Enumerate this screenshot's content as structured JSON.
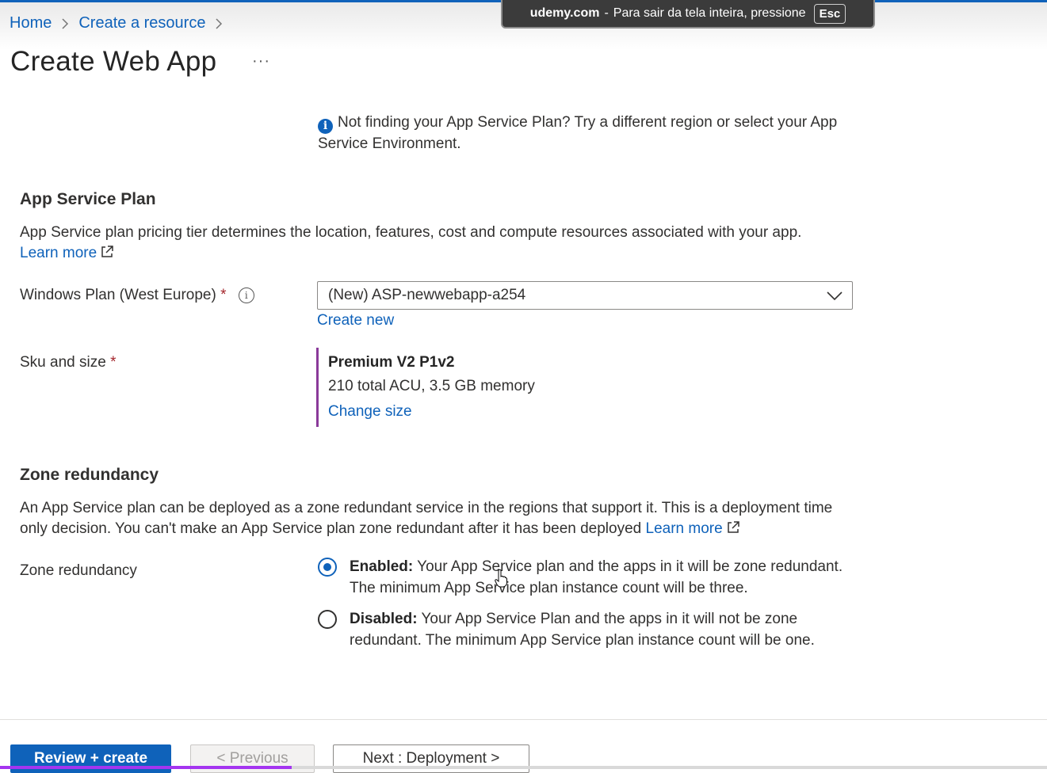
{
  "breadcrumb": {
    "items": [
      "Home",
      "Create a resource"
    ]
  },
  "page": {
    "title": "Create Web App",
    "more_label": "···"
  },
  "fullscreen_toast": {
    "host": "udemy.com",
    "separator": "-",
    "message": "Para sair da tela inteira, pressione",
    "key": "Esc"
  },
  "info_note": {
    "text": "Not finding your App Service Plan? Try a different region or select your App Service Environment."
  },
  "app_service_plan": {
    "title": "App Service Plan",
    "description": "App Service plan pricing tier determines the location, features, cost and compute resources associated with your app.",
    "learn_more": "Learn more",
    "plan_label": "Windows Plan (West Europe)",
    "required_mark": "*",
    "plan_value": "(New) ASP-newwebapp-a254",
    "create_new": "Create new",
    "sku_label": "Sku and size",
    "sku_name": "Premium V2 P1v2",
    "sku_detail": "210 total ACU, 3.5 GB memory",
    "change_size": "Change size"
  },
  "zone_redundancy": {
    "title": "Zone redundancy",
    "description": "An App Service plan can be deployed as a zone redundant service in the regions that support it. This is a deployment time only decision. You can't make an App Service plan zone redundant after it has been deployed",
    "learn_more": "Learn more",
    "label": "Zone redundancy",
    "options": [
      {
        "title": "Enabled:",
        "text": "Your App Service plan and the apps in it will be zone redundant. The minimum App Service plan instance count will be three.",
        "selected": true
      },
      {
        "title": "Disabled:",
        "text": "Your App Service Plan and the apps in it will not be zone redundant. The minimum App Service plan instance count will be one.",
        "selected": false
      }
    ]
  },
  "footer": {
    "review_create": "Review + create",
    "previous": "< Previous",
    "next": "Next : Deployment >"
  },
  "colors": {
    "accent": "#0f62ba",
    "required": "#a4262c",
    "sku_bar": "#8a3a9a",
    "progress": "#a435f0"
  }
}
